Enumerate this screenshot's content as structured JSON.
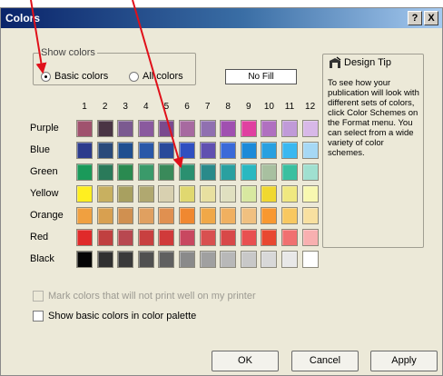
{
  "window": {
    "title": "Colors",
    "help_label": "?",
    "close_label": "X"
  },
  "show_colors": {
    "legend": "Show colors",
    "basic_label": "Basic colors",
    "all_label": "All colors",
    "selected": "basic"
  },
  "no_fill_label": "No Fill",
  "design_tip": {
    "title": "Design Tip",
    "icon": "design-tip-icon",
    "text": "To see how your publication will look with different sets of colors, click Color Schemes on the Format menu. You can select from a wide variety of color schemes."
  },
  "grid": {
    "columns": [
      "1",
      "2",
      "3",
      "4",
      "5",
      "6",
      "7",
      "8",
      "9",
      "10",
      "11",
      "12"
    ],
    "rows": [
      {
        "label": "Purple",
        "colors": [
          "#a0526e",
          "#4a3544",
          "#7b5a90",
          "#8a5a9e",
          "#7a4a8e",
          "#a76aa0",
          "#9070b0",
          "#a050b0",
          "#e040a0",
          "#b070c0",
          "#c09ad8",
          "#d8b8e8"
        ]
      },
      {
        "label": "Blue",
        "colors": [
          "#2c3b8c",
          "#2a4a7a",
          "#1f4f90",
          "#2a58a8",
          "#2a4a9a",
          "#3050c0",
          "#6050b0",
          "#3a6ad8",
          "#1c8ad8",
          "#28a0e0",
          "#3ab8f0",
          "#a6d8f4"
        ]
      },
      {
        "label": "Green",
        "colors": [
          "#1a9a5a",
          "#2a7a5a",
          "#2a8a50",
          "#3a9a6a",
          "#3a8a5a",
          "#2a9070",
          "#2a8a8a",
          "#2aa0a0",
          "#2ab8c0",
          "#a8c0a0",
          "#3ac0a0",
          "#a0e0d0"
        ]
      },
      {
        "label": "Yellow",
        "colors": [
          "#ffef20",
          "#c8b060",
          "#a8a060",
          "#b0a870",
          "#d8d0b0",
          "#e0d870",
          "#e8e0a0",
          "#e0e0c0",
          "#d8e8a0",
          "#f0d830",
          "#f0e880",
          "#f8f8b0"
        ]
      },
      {
        "label": "Orange",
        "colors": [
          "#f0a040",
          "#d8a050",
          "#d09050",
          "#e0a060",
          "#e09050",
          "#f08830",
          "#f0a848",
          "#f0b060",
          "#f0c080",
          "#f89830",
          "#f8c860",
          "#f8e0a0"
        ]
      },
      {
        "label": "Red",
        "colors": [
          "#e02a2a",
          "#c04040",
          "#b84850",
          "#c84040",
          "#d03a3a",
          "#c84860",
          "#d85050",
          "#d84848",
          "#e85050",
          "#e84830",
          "#f07070",
          "#f8b0b0"
        ]
      },
      {
        "label": "Black",
        "colors": [
          "#050505",
          "#303030",
          "#3a3a3a",
          "#505050",
          "#606060",
          "#8a8a8a",
          "#a0a0a0",
          "#b8b8b8",
          "#c8c8c8",
          "#d8d8d8",
          "#e8e8e8",
          "#ffffff"
        ]
      }
    ]
  },
  "options": {
    "mark_label": "Mark colors that will not print well on my printer",
    "mark_checked": false,
    "mark_disabled": true,
    "basic_palette_label": "Show basic colors in color palette",
    "basic_palette_checked": false
  },
  "buttons": {
    "ok": "OK",
    "cancel": "Cancel",
    "apply": "Apply"
  },
  "annotation_color": "#e0101a"
}
